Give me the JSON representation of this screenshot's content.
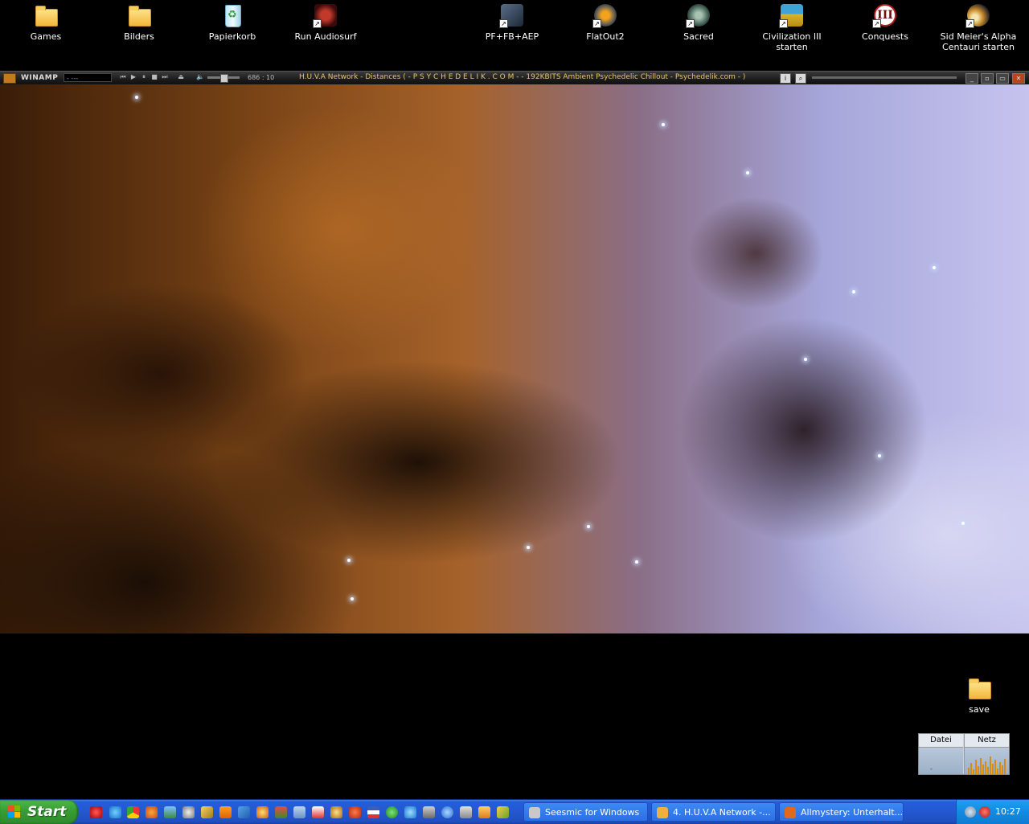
{
  "desktop": {
    "icons": [
      {
        "label": "Games",
        "kind": "folder"
      },
      {
        "label": "Bilders",
        "kind": "folder"
      },
      {
        "label": "Papierkorb",
        "kind": "recycle-bin"
      },
      {
        "label": "Run Audiosurf",
        "kind": "shortcut"
      },
      {
        "label": "PF+FB+AEP",
        "kind": "shortcut"
      },
      {
        "label": "FlatOut2",
        "kind": "shortcut"
      },
      {
        "label": "Sacred",
        "kind": "shortcut"
      },
      {
        "label": "Civilization III starten",
        "kind": "shortcut"
      },
      {
        "label": "Conquests",
        "kind": "shortcut"
      },
      {
        "label": "Sid Meier's Alpha Centauri starten",
        "kind": "shortcut"
      }
    ],
    "save_icon_label": "save"
  },
  "winamp": {
    "logo_text": "WINAMP",
    "time_display": "- ---",
    "kbps_display": "686 : 10",
    "song_title": "H.U.V.A Network - Distances ( -  P S Y C H E D E L I K . C O M - -    192KBITS   Ambient Psychedelic Chillout - Psychedelik.com -  )",
    "accent_color": "#e7c66a"
  },
  "gadget": {
    "col1_label": "Datei",
    "col2_label": "Netz",
    "col1_value": "-",
    "net_bars": [
      8,
      14,
      6,
      18,
      10,
      20,
      12,
      16,
      9,
      22,
      13,
      18,
      7,
      15,
      11,
      19
    ]
  },
  "taskbar": {
    "start_label": "Start",
    "tasks": [
      {
        "label": "Seesmic for Windows",
        "icon_color": "#c9c9c9"
      },
      {
        "label": "4. H.U.V.A Network -...",
        "icon_color": "#f0b040"
      },
      {
        "label": "Allmystery: Unterhalt...",
        "icon_color": "#e2681c"
      }
    ],
    "clock": "10:27"
  }
}
